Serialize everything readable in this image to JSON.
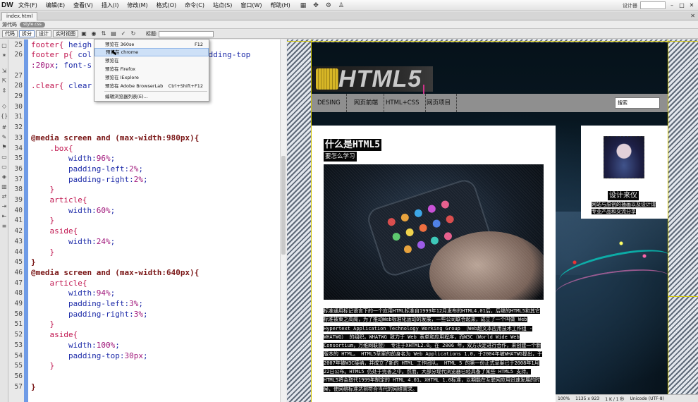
{
  "app": {
    "logo": "DW",
    "menus": [
      "文件(F)",
      "编辑(E)",
      "查看(V)",
      "插入(I)",
      "修改(M)",
      "格式(O)",
      "命令(C)",
      "站点(S)",
      "窗口(W)",
      "帮助(H)"
    ],
    "workspace_label": "设计器",
    "window_buttons": [
      "–",
      "□",
      "✕"
    ]
  },
  "document": {
    "tab_label": "index.html",
    "source_label": "源代码",
    "related_file": "style.css",
    "view_buttons": [
      "代码",
      "拆分",
      "设计",
      "实时视图"
    ],
    "title_label": "标题:",
    "title_value": ""
  },
  "code": {
    "lines": [
      {
        "n": "25",
        "parts": [
          {
            "c": "c-sel",
            "t": "footer"
          },
          {
            "c": "c-br",
            "t": "{ "
          },
          {
            "c": "c-prop",
            "t": "heigh"
          }
        ]
      },
      {
        "n": "26",
        "parts": [
          {
            "c": "c-sel",
            "t": "footer p"
          },
          {
            "c": "c-br",
            "t": "{ "
          },
          {
            "c": "c-prop",
            "t": "col"
          },
          {
            "c": "c-val",
            "t": "                    r; "
          },
          {
            "c": "c-prop",
            "t": "padding-top"
          }
        ]
      },
      {
        "n": "",
        "parts": [
          {
            "c": "c-num",
            "t": ":20px"
          },
          {
            "c": "c-prop",
            "t": "; font-s"
          }
        ]
      },
      {
        "n": "27",
        "parts": []
      },
      {
        "n": "28",
        "parts": [
          {
            "c": "c-sel",
            "t": ".clear"
          },
          {
            "c": "c-br",
            "t": "{ "
          },
          {
            "c": "c-prop",
            "t": "clear"
          }
        ]
      },
      {
        "n": "29",
        "parts": []
      },
      {
        "n": "30",
        "parts": []
      },
      {
        "n": "31",
        "parts": []
      },
      {
        "n": "32",
        "parts": []
      },
      {
        "n": "33",
        "parts": [
          {
            "c": "c-at",
            "t": "@media screen and (max-width:980px){"
          }
        ]
      },
      {
        "n": "34",
        "parts": [
          {
            "c": "c-sel",
            "t": "    .box{"
          }
        ]
      },
      {
        "n": "35",
        "parts": [
          {
            "c": "c-prop",
            "t": "        width:"
          },
          {
            "c": "c-num",
            "t": "96%"
          },
          {
            "c": "c-prop",
            "t": ";"
          }
        ]
      },
      {
        "n": "36",
        "parts": [
          {
            "c": "c-prop",
            "t": "        padding-left:"
          },
          {
            "c": "c-num",
            "t": "2%"
          },
          {
            "c": "c-prop",
            "t": ";"
          }
        ]
      },
      {
        "n": "37",
        "parts": [
          {
            "c": "c-prop",
            "t": "        padding-right:"
          },
          {
            "c": "c-num",
            "t": "2%"
          },
          {
            "c": "c-prop",
            "t": ";"
          }
        ]
      },
      {
        "n": "38",
        "parts": [
          {
            "c": "c-br",
            "t": "    }"
          }
        ]
      },
      {
        "n": "39",
        "parts": [
          {
            "c": "c-sel",
            "t": "    article{"
          }
        ]
      },
      {
        "n": "40",
        "parts": [
          {
            "c": "c-prop",
            "t": "        width:"
          },
          {
            "c": "c-num",
            "t": "60%"
          },
          {
            "c": "c-prop",
            "t": ";"
          }
        ]
      },
      {
        "n": "41",
        "parts": [
          {
            "c": "c-br",
            "t": "    }"
          }
        ]
      },
      {
        "n": "42",
        "parts": [
          {
            "c": "c-sel",
            "t": "    aside{"
          }
        ]
      },
      {
        "n": "43",
        "parts": [
          {
            "c": "c-prop",
            "t": "        width:"
          },
          {
            "c": "c-num",
            "t": "24%"
          },
          {
            "c": "c-prop",
            "t": ";"
          }
        ]
      },
      {
        "n": "44",
        "parts": [
          {
            "c": "c-br",
            "t": "    }"
          }
        ]
      },
      {
        "n": "45",
        "parts": [
          {
            "c": "c-at",
            "t": "}"
          }
        ]
      },
      {
        "n": "46",
        "parts": [
          {
            "c": "c-at",
            "t": "@media screen and (max-width:640px){"
          }
        ]
      },
      {
        "n": "47",
        "parts": [
          {
            "c": "c-sel",
            "t": "    article{"
          }
        ]
      },
      {
        "n": "48",
        "parts": [
          {
            "c": "c-prop",
            "t": "        width:"
          },
          {
            "c": "c-num",
            "t": "94%"
          },
          {
            "c": "c-prop",
            "t": ";"
          }
        ]
      },
      {
        "n": "49",
        "parts": [
          {
            "c": "c-prop",
            "t": "        padding-left:"
          },
          {
            "c": "c-num",
            "t": "3%"
          },
          {
            "c": "c-prop",
            "t": ";"
          }
        ]
      },
      {
        "n": "50",
        "parts": [
          {
            "c": "c-prop",
            "t": "        padding-right:"
          },
          {
            "c": "c-num",
            "t": "3%"
          },
          {
            "c": "c-prop",
            "t": ";"
          }
        ]
      },
      {
        "n": "51",
        "parts": [
          {
            "c": "c-br",
            "t": "    }"
          }
        ]
      },
      {
        "n": "52",
        "parts": [
          {
            "c": "c-sel",
            "t": "    aside{"
          }
        ]
      },
      {
        "n": "53",
        "parts": [
          {
            "c": "c-prop",
            "t": "        width:"
          },
          {
            "c": "c-num",
            "t": "100%"
          },
          {
            "c": "c-prop",
            "t": ";"
          }
        ]
      },
      {
        "n": "54",
        "parts": [
          {
            "c": "c-prop",
            "t": "        padding-top:"
          },
          {
            "c": "c-num",
            "t": "30px"
          },
          {
            "c": "c-prop",
            "t": ";"
          }
        ]
      },
      {
        "n": "55",
        "parts": [
          {
            "c": "c-br",
            "t": "    }"
          }
        ]
      },
      {
        "n": "56",
        "parts": []
      },
      {
        "n": "57",
        "parts": [
          {
            "c": "c-at",
            "t": "}"
          }
        ]
      }
    ]
  },
  "preview_menu": {
    "items": [
      {
        "label": "预览在 360se",
        "shortcut": "F12"
      },
      {
        "label": "预览在 chrome",
        "shortcut": ""
      },
      {
        "label": "预览在",
        "shortcut": ""
      },
      {
        "label": "预览在 Firefox",
        "shortcut": ""
      },
      {
        "label": "预览在 IExplore",
        "shortcut": ""
      },
      {
        "label": "预览在 Adobe BrowserLab",
        "shortcut": "Ctrl+Shift+F12"
      },
      {
        "label": "编辑浏览器列表(E)...",
        "shortcut": ""
      }
    ]
  },
  "site": {
    "logo_text": "HTML5",
    "nav": [
      "DESING",
      "网页前端",
      "HTML+CSS",
      "网页项目"
    ],
    "search_value": "搜索",
    "article": {
      "title": "什么是HTML5",
      "subtitle": "要怎么学习",
      "paragraphs": [
        "标准通用标记语言下的一个应用HTML标准自1999年12月发布的HTML4.01后，后继的HTML5和其它标准被束之高阁，为了推动Web标准化运动的发展，一些公司联合起来，成立了一个叫做 Web Hypertext Application Technology Working Group （Web超文本应用技术工作组 -WHATWG） 的组织。WHATWG 致力于 Web 表单和应用程序，而W3C（World Wide Web Consortium，万维网联盟） 专注于XHTML2.0。在 2006 年，双方决定进行合作，来创建一个新版本的 HTML。 HTML5草案的前身名为 Web Applications 1.0，于2004年被WHATWG提出，于2007年被W3C接纳，并成立了新的 HTML 工作团队。 HTML 5 的第一份正式草案已于2008年1月22日公布。HTML5 仍处于完善之中。然而，大部分现代浏览器已经具备了某些 HTML5 支持。 HTML5将会取代1999年制定的 HTML 4.01、XHTML 1.0标准，以期能在互联网应用迅速发展的时候，使网络标准达到符合当代的网络需求。"
      ]
    },
    "aside": {
      "name": "设计来仪",
      "desc": "网站与原创的插画以及设计请专业产品和交流分享"
    }
  },
  "statusbar": {
    "zoom": "100%",
    "size": "1135 x 923",
    "size_kb": "1 K / 1 秒",
    "encoding": "Unicode (UTF-8)"
  },
  "colors": {
    "gutter_accent": "#6f9be6",
    "selector": "#c0144e",
    "at_rule": "#7a1717",
    "property": "#1c2aa8",
    "number": "#a0167a",
    "guide_lines": "#d3c600"
  }
}
